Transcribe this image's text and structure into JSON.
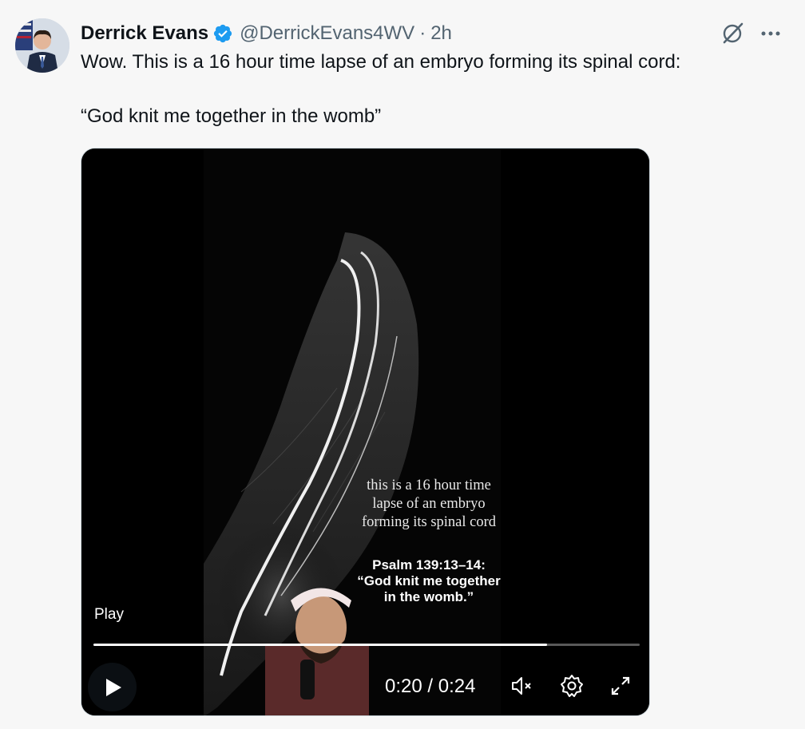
{
  "post": {
    "author_name": "Derrick Evans",
    "handle": "@DerrickEvans4WV",
    "separator": "·",
    "time": "2h",
    "text_line_1": "Wow. This is a 16 hour time lapse of an embryo forming its spinal cord:",
    "text_line_2": "“God knit me together in the womb”"
  },
  "icons": {
    "verified": "verified-badge-icon",
    "grok": "grok-icon",
    "more": "more-options-icon",
    "play": "play-icon",
    "mute": "volume-muted-icon",
    "settings": "gear-icon",
    "fullscreen": "expand-icon"
  },
  "video": {
    "caption_lines": [
      "this is a 16 hour time",
      "lapse of an embryo",
      "forming its spinal cord"
    ],
    "verse_lines": [
      "Psalm 139:13–14:",
      "“God knit me together",
      "in the womb.”"
    ],
    "play_label": "Play",
    "time_readout": "0:20 / 0:24",
    "progress_fraction": 0.83
  },
  "colors": {
    "verified": "#1d9bf0",
    "secondary_text": "#536471",
    "page_bg": "#f7f7f7"
  }
}
